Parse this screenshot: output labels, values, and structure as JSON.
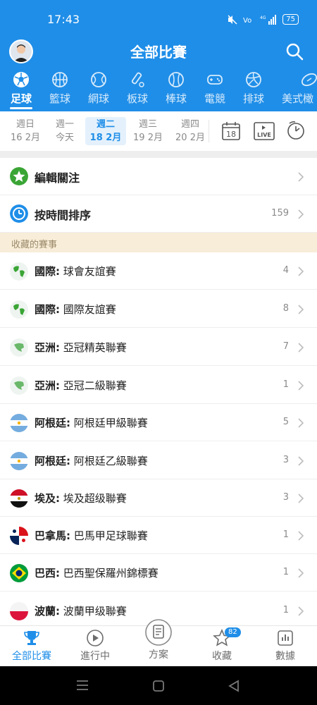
{
  "status": {
    "time": "17:43",
    "battery": "75"
  },
  "header": {
    "title": "全部比賽"
  },
  "sports": [
    {
      "label": "足球",
      "icon": "soccer-icon"
    },
    {
      "label": "籃球",
      "icon": "basketball-icon"
    },
    {
      "label": "網球",
      "icon": "tennis-icon"
    },
    {
      "label": "板球",
      "icon": "cricket-icon"
    },
    {
      "label": "棒球",
      "icon": "baseball-icon"
    },
    {
      "label": "電競",
      "icon": "esports-icon"
    },
    {
      "label": "排球",
      "icon": "volleyball-icon"
    },
    {
      "label": "美式橄",
      "icon": "american-football-icon"
    }
  ],
  "dates": [
    {
      "day": "週日",
      "date": "16 2月"
    },
    {
      "day": "週一",
      "date": "今天"
    },
    {
      "day": "週二",
      "date": "18 2月"
    },
    {
      "day": "週三",
      "date": "19 2月"
    },
    {
      "day": "週四",
      "date": "20 2月"
    }
  ],
  "tools": {
    "calendar_day": "18",
    "live_label": "LIVE"
  },
  "actions": {
    "edit_follow": "編輯關注",
    "sort_by_time": "按時間排序",
    "sort_count": "159"
  },
  "section_title": "收藏的賽事",
  "leagues": [
    {
      "region": "國際:",
      "name": "球會友誼賽",
      "count": "4"
    },
    {
      "region": "國際:",
      "name": "國際友誼賽",
      "count": "8"
    },
    {
      "region": "亞洲:",
      "name": "亞冠精英聯賽",
      "count": "7"
    },
    {
      "region": "亞洲:",
      "name": "亞冠二級聯賽",
      "count": "1"
    },
    {
      "region": "阿根廷:",
      "name": "阿根廷甲級聯賽",
      "count": "5"
    },
    {
      "region": "阿根廷:",
      "name": "阿根廷乙級聯賽",
      "count": "3"
    },
    {
      "region": "埃及:",
      "name": "埃及超级聯賽",
      "count": "3"
    },
    {
      "region": "巴拿馬:",
      "name": "巴馬甲足球聯賽",
      "count": "1"
    },
    {
      "region": "巴西:",
      "name": "巴西聖保羅州錦標賽",
      "count": "1"
    },
    {
      "region": "波蘭:",
      "name": "波蘭甲级聯賽",
      "count": "1"
    }
  ],
  "bottom_nav": [
    {
      "label": "全部比賽"
    },
    {
      "label": "進行中"
    },
    {
      "label": "方案"
    },
    {
      "label": "收藏",
      "badge": "82"
    },
    {
      "label": "數據"
    }
  ],
  "colors": {
    "primary": "#1f8ee8",
    "section_bg": "#f8edd8",
    "green": "#3aa535"
  }
}
